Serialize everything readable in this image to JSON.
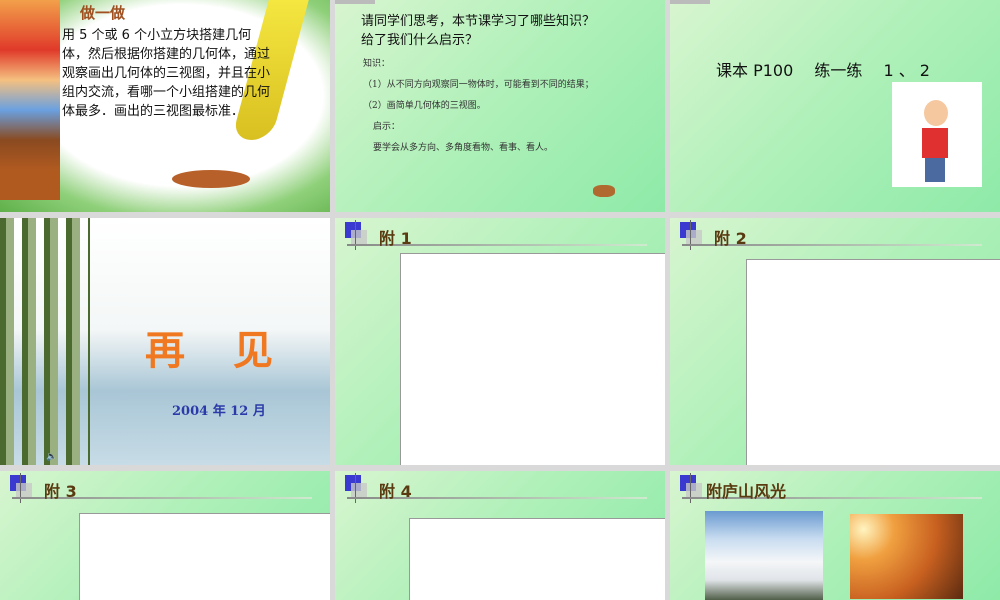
{
  "slides": [
    {
      "title": "做一做",
      "body": "用 5 个或 6 个小立方块搭建几何体，然后根据你搭建的几何体，通过观察画出几何体的三视图，并且在小组内交流，看哪一个小组搭建的几何体最多．画出的三视图最标准．"
    },
    {
      "question1": "请同学们思考，本节课学习了哪些知识？",
      "question2": "给了我们什么启示？",
      "knowledge_label": "知识：",
      "item1": "（1）从不同方向观察同一物体时，可能看到不同的结果；",
      "item2": "（2）画简单几何体的三视图。",
      "insight_label": "启示：",
      "insight": "要学会从多方向、多角度看物、看事、看人。"
    },
    {
      "text": "课本 P100　 练一练　 1 、 2"
    },
    {
      "title": "再　见",
      "date": "2004 年 12 月"
    },
    {
      "title": "附 1"
    },
    {
      "title": "附 2"
    },
    {
      "title": "附 3"
    },
    {
      "title": "附 4"
    },
    {
      "title": "附庐山风光"
    }
  ],
  "colors": {
    "accent": "#3a3ad0",
    "title_brown": "#5a3a10",
    "goodbye_orange": "#f07820",
    "date_blue": "#2a3aa8"
  }
}
